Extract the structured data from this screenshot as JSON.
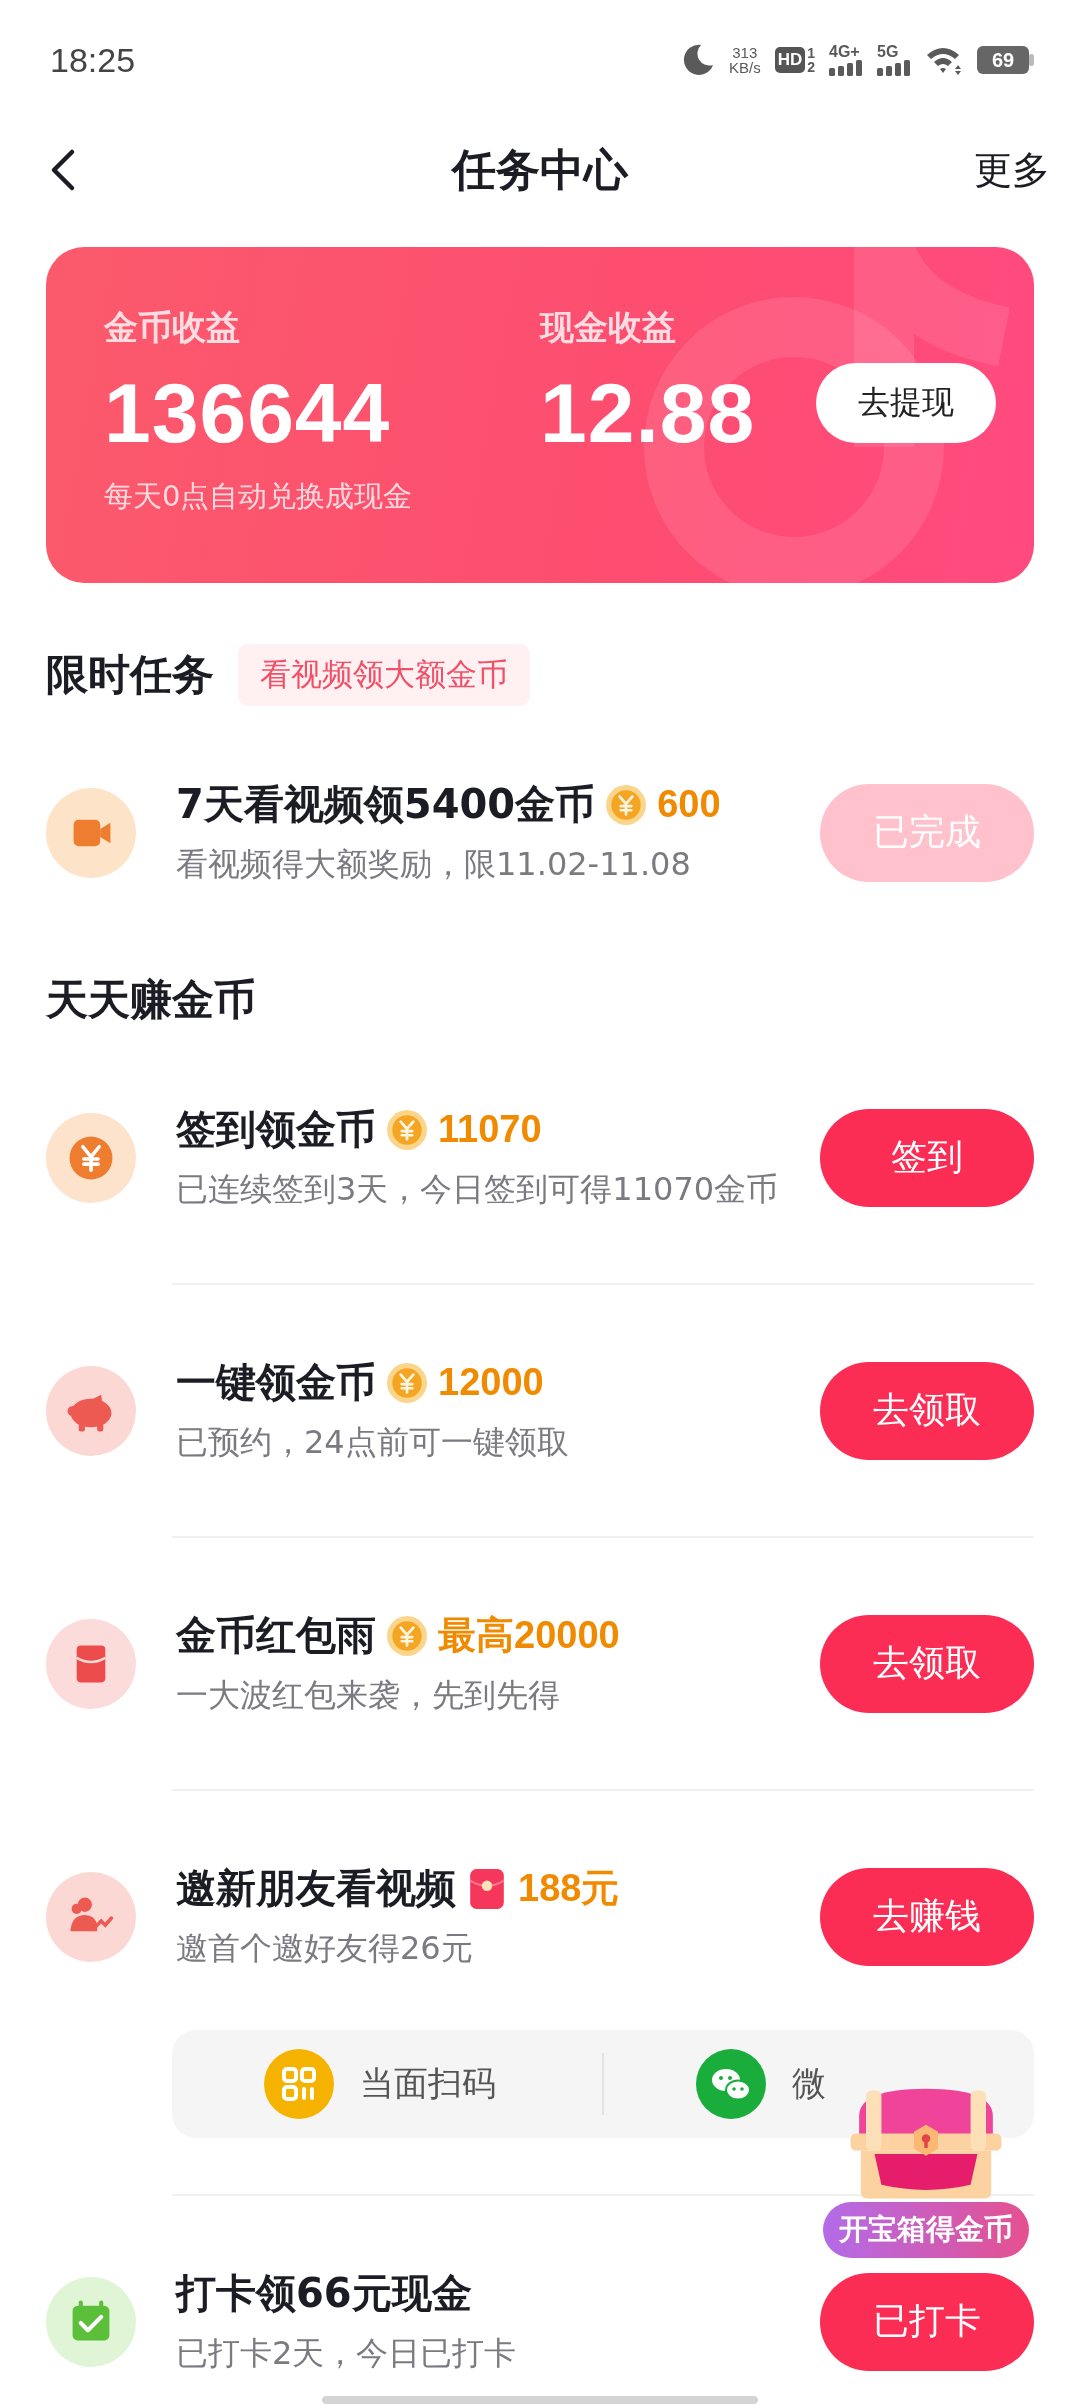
{
  "status_bar": {
    "time": "18:25",
    "speed_value": "313",
    "speed_unit": "KB/s",
    "hd_label": "HD",
    "sim_1": "1",
    "sim_2": "2",
    "network_1": "4G+",
    "network_2": "5G",
    "battery": "69"
  },
  "header": {
    "title": "任务中心",
    "more": "更多"
  },
  "earnings": {
    "coins_label": "金币收益",
    "coins": "136644",
    "cash_label": "现金收益",
    "cash": "12.88",
    "withdraw": "去提现",
    "note": "每天0点自动兑换成现金"
  },
  "limited": {
    "title": "限时任务",
    "tag": "看视频领大额金币",
    "tasks": [
      {
        "kind": "coin",
        "title": "7天看视频领5400金币",
        "reward": "600",
        "subtitle": "看视频得大额奖励，限11.02-11.08",
        "button": "已完成",
        "done": true
      }
    ]
  },
  "daily": {
    "title": "天天赚金币",
    "tasks": [
      {
        "kind": "coin",
        "title": "签到领金币",
        "reward": "11070",
        "subtitle": "已连续签到3天，今日签到可得11070金币",
        "button": "签到",
        "done": false
      },
      {
        "kind": "coin",
        "title": "一键领金币",
        "reward": "12000",
        "subtitle": "已预约，24点前可一键领取",
        "button": "去领取",
        "done": false
      },
      {
        "kind": "coin",
        "title": "金币红包雨",
        "reward": "最高20000",
        "subtitle": "一大波红包来袭，先到先得",
        "button": "去领取",
        "done": false
      },
      {
        "kind": "red_packet",
        "title": "邀新朋友看视频",
        "reward": "188元",
        "subtitle": "邀首个邀好友得26元",
        "button": "去赚钱",
        "done": false,
        "share_options": [
          {
            "label": "当面扫码"
          },
          {
            "label": "微"
          }
        ]
      },
      {
        "kind": "plain",
        "title": "打卡领66元现金",
        "subtitle": "已打卡2天，今日已打卡",
        "button": "已打卡",
        "done": false
      }
    ]
  },
  "floating_chest": {
    "label": "开宝箱得金币"
  }
}
